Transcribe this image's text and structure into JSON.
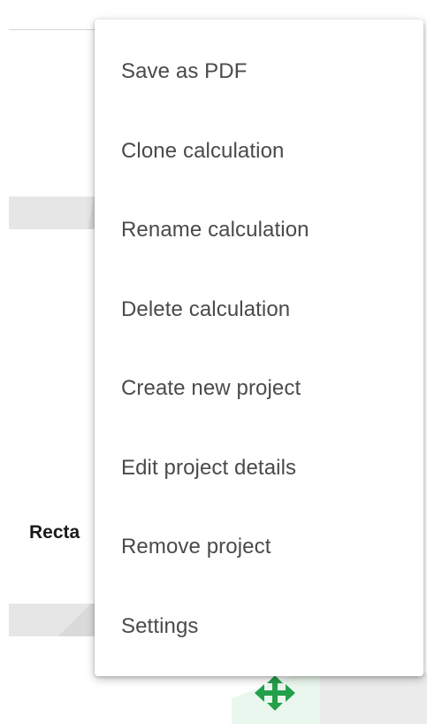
{
  "background": {
    "label_fragment": "Recta"
  },
  "menu": {
    "items": [
      {
        "label": "Save as PDF"
      },
      {
        "label": "Clone calculation"
      },
      {
        "label": "Rename calculation"
      },
      {
        "label": "Delete calculation"
      },
      {
        "label": "Create new project"
      },
      {
        "label": "Edit project details"
      },
      {
        "label": "Remove project"
      },
      {
        "label": "Settings"
      }
    ]
  },
  "icons": {
    "move": "move-arrows-icon"
  },
  "colors": {
    "accent_green": "#23a04a",
    "menu_text": "#4a4a4a",
    "menu_bg": "#ffffff"
  }
}
